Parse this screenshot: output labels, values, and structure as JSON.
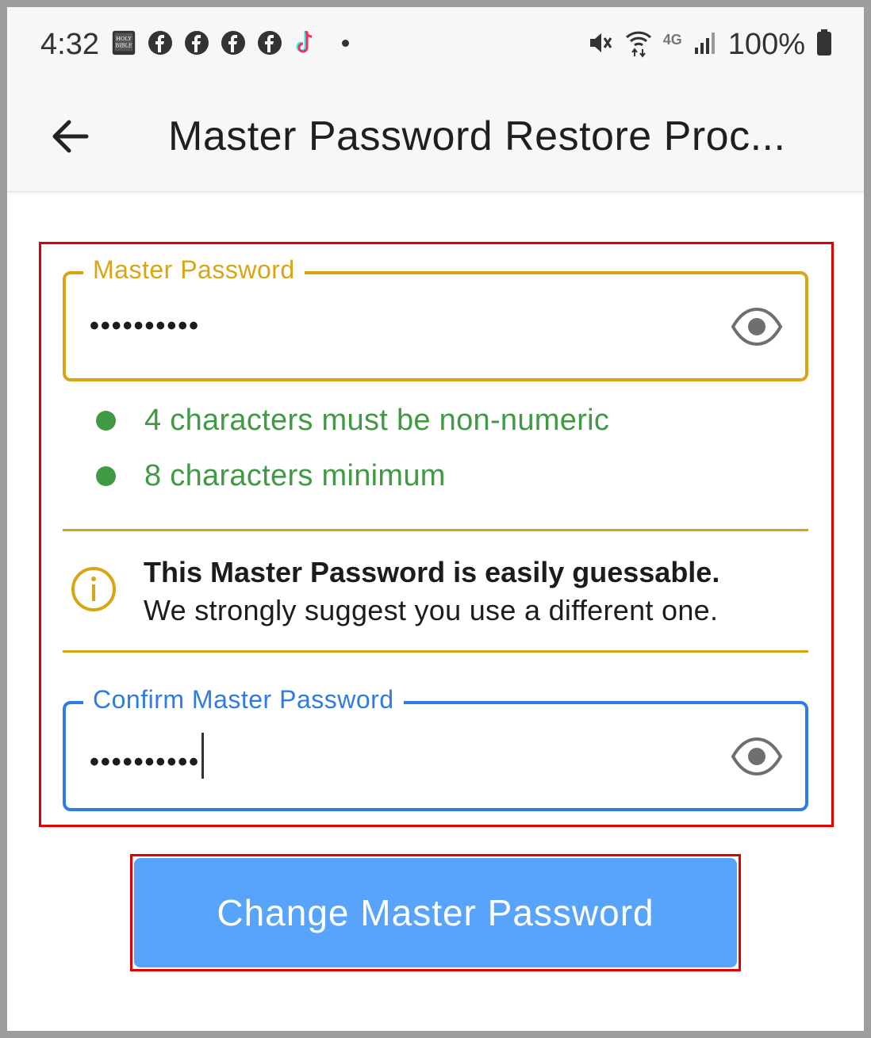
{
  "status_bar": {
    "time": "4:32",
    "notification_icons": [
      "holy-bible-app-icon",
      "facebook-icon",
      "facebook-icon",
      "facebook-icon",
      "facebook-icon",
      "tiktok-icon"
    ],
    "battery": "100%",
    "network": "4G"
  },
  "app_bar": {
    "title": "Master Password Restore Proc..."
  },
  "master_password": {
    "label": "Master Password",
    "value": "••••••••••"
  },
  "rules": [
    {
      "text": "4 characters must be non-numeric",
      "status": "met"
    },
    {
      "text": "8 characters minimum",
      "status": "met"
    }
  ],
  "warning": {
    "title": "This Master Password is easily guessable.",
    "body": "We strongly suggest you use a different one."
  },
  "confirm_password": {
    "label": "Confirm Master Password",
    "value": "••••••••••"
  },
  "submit": {
    "label": "Change Master Password"
  },
  "colors": {
    "accent_warning": "#d9a514",
    "accent_focus": "#2f7be6",
    "rule_ok": "#3f9a43",
    "button": "#57a4fa",
    "highlight_box": "#e00000"
  }
}
